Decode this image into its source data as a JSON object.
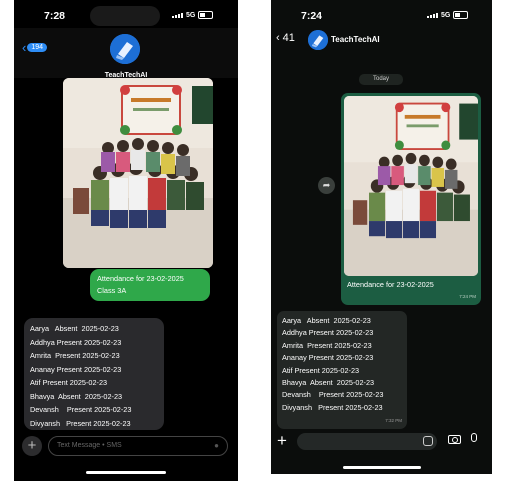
{
  "left_phone": {
    "status": {
      "time": "7:28",
      "network": "5G"
    },
    "header": {
      "back_count": "194",
      "contact_name": "TeachTechAI"
    },
    "sent_message": {
      "lines": [
        "Attendance for 23-02-2025",
        "Class 3A"
      ]
    },
    "attendance_list": [
      "Aarya   Absent  2025-02-23",
      "Addhya Present 2025-02-23",
      "Amrita  Present 2025-02-23",
      "Ananay Present 2025-02-23",
      "Atif Present 2025-02-23",
      "Bhavya  Absent  2025-02-23",
      "Devansh    Present 2025-02-23",
      "Divyansh   Present 2025-02-23"
    ],
    "input": {
      "placeholder": "Text Message • SMS"
    }
  },
  "right_phone": {
    "status": {
      "time": "7:24",
      "network": "5G"
    },
    "header": {
      "back_count": "41",
      "contact_name": "TeachTechAI"
    },
    "date_label": "Today",
    "media_caption": "Attendance for 23-02-2025",
    "media_time": "7:24 PM",
    "attendance_list": [
      "Aarya   Absent  2025-02-23",
      "Addhya Present 2025-02-23",
      "Amrita  Present 2025-02-23",
      "Ananay Present 2025-02-23",
      "Atif Present 2025-02-23",
      "Bhavya  Absent  2025-02-23",
      "Devansh    Present 2025-02-23",
      "Divyansh   Present 2025-02-23"
    ],
    "list_time": "7:32 PM"
  },
  "colors": {
    "imessage_blue": "#2e8df5",
    "sms_green": "#2fa84a",
    "whatsapp_bubble": "#1c5d42",
    "received_bubble": "#2a2a2d"
  },
  "icons": [
    "back-chevron-icon",
    "plus-icon",
    "mic-icon",
    "camera-icon",
    "sticker-icon",
    "forward-icon",
    "signal-icon",
    "battery-icon"
  ]
}
